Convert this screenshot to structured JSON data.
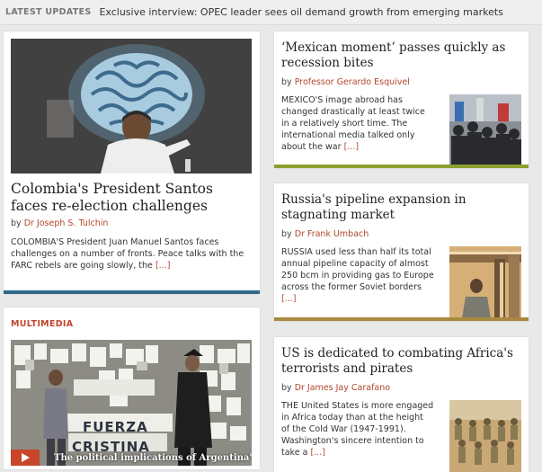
{
  "ticker": {
    "label": "LATEST UPDATES",
    "headline": "Exclusive interview: OPEC leader sees oil demand growth from emerging markets"
  },
  "feature": {
    "title": "Colombia's President Santos faces re-election challenges",
    "by": "by",
    "author": "Dr Joseph S. Tulchin",
    "excerpt": "COLOMBIA'S President Juan Manuel Santos faces challenges on a number of fronts. Peace talks with the FARC rebels are going slowly, the",
    "more": "[...]",
    "accent": "#2f6a8a"
  },
  "articles": [
    {
      "title": "‘Mexican moment’ passes quickly as recession bites",
      "by": "by",
      "author": "Professor Gerardo Esquivel",
      "excerpt": "MEXICO'S image abroad has changed drastically at least twice in a relatively short time. The international media talked only about the war",
      "more": "[...]",
      "accent": "#8aa12f",
      "thumb_icon": "protest-crowd-photo"
    },
    {
      "title": "Russia's pipeline expansion in stagnating market",
      "by": "by",
      "author": "Dr Frank Umbach",
      "excerpt": "RUSSIA used less than half its total annual pipeline capacity of almost 250 bcm in providing gas to Europe across the former Soviet borders",
      "more": "[...]",
      "accent": "#a8893e",
      "thumb_icon": "pipeline-photo"
    },
    {
      "title": "US is dedicated to combating Africa's terrorists and pirates",
      "by": "by",
      "author": "Dr James Jay Carafano",
      "excerpt": "THE United States is more engaged in Africa today than at the height of the Cold War (1947-1991). Washington's sincere intention to take a",
      "more": "[...]",
      "accent": "#8a8a8a",
      "thumb_icon": "soldiers-marching-photo"
    }
  ],
  "multimedia": {
    "label": "MULTIMEDIA",
    "caption": "The political implications of Argentina's",
    "wall_text_1": "FUERZA",
    "wall_text_2": "CRISTINA"
  }
}
